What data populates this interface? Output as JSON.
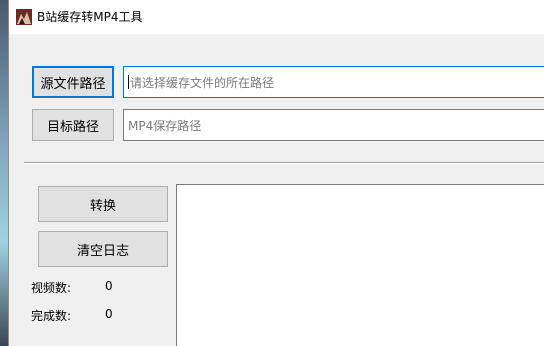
{
  "window": {
    "title": "B站缓存转MP4工具"
  },
  "paths": {
    "source_button": "源文件路径",
    "source_placeholder": "请选择缓存文件的所在路径",
    "target_button": "目标路径",
    "target_placeholder": "MP4保存路径"
  },
  "actions": {
    "convert_label": "转换",
    "clear_log_label": "清空日志"
  },
  "stats": {
    "video_count_label": "视频数:",
    "video_count_value": "0",
    "completed_count_label": "完成数:",
    "completed_count_value": "0"
  },
  "icons": {
    "app": "b-site-app-icon"
  }
}
